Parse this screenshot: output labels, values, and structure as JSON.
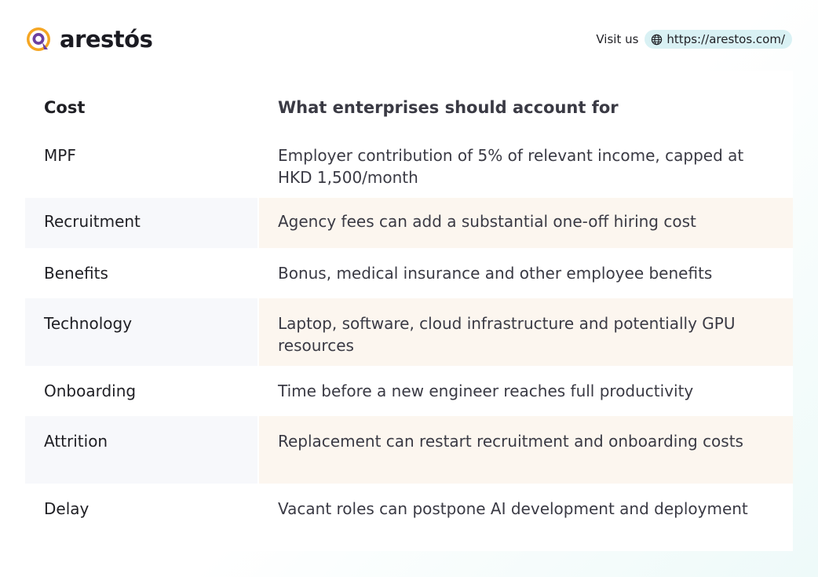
{
  "brand": {
    "name": "arestós"
  },
  "visit": {
    "label": "Visit us",
    "url": "https://arestos.com/"
  },
  "table": {
    "headers": [
      "Cost",
      "What enterprises should account for"
    ],
    "rows": [
      {
        "cost": "MPF",
        "description": "Employer contribution of 5% of relevant income, capped at HKD 1,500/month"
      },
      {
        "cost": "Recruitment",
        "description": "Agency fees can add a substantial one-off hiring cost"
      },
      {
        "cost": "Benefits",
        "description": "Bonus, medical insurance and other employee benefits"
      },
      {
        "cost": "Technology",
        "description": "Laptop, software, cloud infrastructure and potentially GPU resources"
      },
      {
        "cost": "Onboarding",
        "description": "Time before a new engineer reaches full productivity"
      },
      {
        "cost": "Attrition",
        "description": "Replacement can restart recruitment and onboarding costs"
      },
      {
        "cost": "Delay",
        "description": "Vacant roles can postpone AI development and deployment"
      }
    ]
  },
  "colors": {
    "brand_orange": "#f5a623",
    "brand_purple": "#6b3fa0",
    "header_accent": "#fdf0dd",
    "row_alt": "#fcf6ef",
    "url_pill": "#d9f1f4"
  },
  "icons": {
    "logo": "arestos-logo-icon",
    "globe": "globe-icon"
  }
}
